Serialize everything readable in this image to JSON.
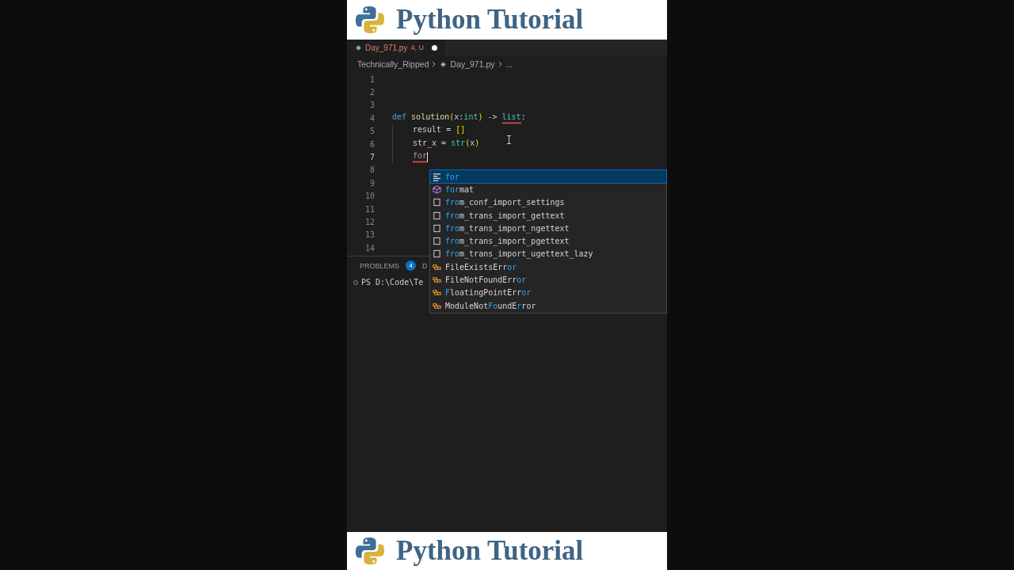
{
  "header": {
    "title": "Python Tutorial"
  },
  "tab": {
    "filename": "Day_971.py",
    "status": "4, U",
    "modified": true
  },
  "breadcrumb": {
    "folder": "Technically_Ripped",
    "file": "Day_971.py",
    "rest": "..."
  },
  "code_lines": [
    {
      "number": "1",
      "current": false
    },
    {
      "number": "2",
      "current": false
    },
    {
      "number": "3",
      "current": false
    },
    {
      "number": "4",
      "current": false,
      "tokens": [
        {
          "text": "def ",
          "kind": "keyword"
        },
        {
          "text": "solution",
          "kind": "function"
        },
        {
          "text": "(",
          "kind": "bracket"
        },
        {
          "text": "x",
          "kind": "param"
        },
        {
          "text": ":",
          "kind": "plain"
        },
        {
          "text": "int",
          "kind": "type"
        },
        {
          "text": ")",
          "kind": "bracket"
        },
        {
          "text": " -> ",
          "kind": "plain"
        },
        {
          "text": "list",
          "kind": "type",
          "error": true
        },
        {
          "text": ":",
          "kind": "plain"
        }
      ]
    },
    {
      "number": "5",
      "current": false,
      "indented": true,
      "tokens": [
        {
          "text": "result = ",
          "kind": "plain"
        },
        {
          "text": "[]",
          "kind": "bracket"
        }
      ]
    },
    {
      "number": "6",
      "current": false,
      "indented": true,
      "tokens": [
        {
          "text": "str_x = ",
          "kind": "plain"
        },
        {
          "text": "str",
          "kind": "type"
        },
        {
          "text": "(",
          "kind": "bracket"
        },
        {
          "text": "x",
          "kind": "param"
        },
        {
          "text": ")",
          "kind": "bracket"
        }
      ]
    },
    {
      "number": "7",
      "current": true,
      "indented": true,
      "tokens": [
        {
          "text": "for",
          "kind": "keyword2",
          "error": true
        }
      ]
    },
    {
      "number": "8",
      "current": false
    },
    {
      "number": "9",
      "current": false
    },
    {
      "number": "10",
      "current": false
    },
    {
      "number": "11",
      "current": false
    },
    {
      "number": "12",
      "current": false
    },
    {
      "number": "13",
      "current": false
    },
    {
      "number": "14",
      "current": false
    }
  ],
  "panel": {
    "tab": "PROBLEMS",
    "count": "4",
    "next_tab": "D",
    "terminal": "PS D:\\Code\\Te"
  },
  "suggestions": [
    {
      "kind": "keyword",
      "selected": true,
      "segments": [
        {
          "text": "for",
          "match": true
        }
      ]
    },
    {
      "kind": "method",
      "selected": false,
      "segments": [
        {
          "text": "for",
          "match": true
        },
        {
          "text": "mat",
          "match": false
        }
      ]
    },
    {
      "kind": "snippet",
      "selected": false,
      "segments": [
        {
          "text": "fro",
          "match": true
        },
        {
          "text": "m_conf_import_settings",
          "match": false
        }
      ]
    },
    {
      "kind": "snippet",
      "selected": false,
      "segments": [
        {
          "text": "fro",
          "match": true
        },
        {
          "text": "m_trans_import_gettext",
          "match": false
        }
      ]
    },
    {
      "kind": "snippet",
      "selected": false,
      "segments": [
        {
          "text": "fro",
          "match": true
        },
        {
          "text": "m_trans_import_ngettext",
          "match": false
        }
      ]
    },
    {
      "kind": "snippet",
      "selected": false,
      "segments": [
        {
          "text": "fro",
          "match": true
        },
        {
          "text": "m_trans_import_pgettext",
          "match": false
        }
      ]
    },
    {
      "kind": "snippet",
      "selected": false,
      "segments": [
        {
          "text": "fro",
          "match": true
        },
        {
          "text": "m_trans_import_ugettext_lazy",
          "match": false
        }
      ]
    },
    {
      "kind": "class",
      "selected": false,
      "segments": [
        {
          "text": "FileExistsErr",
          "match": false
        },
        {
          "text": "or",
          "match": true
        }
      ]
    },
    {
      "kind": "class",
      "selected": false,
      "segments": [
        {
          "text": "FileNotFoundErr",
          "match": false
        },
        {
          "text": "or",
          "match": true
        }
      ]
    },
    {
      "kind": "class",
      "selected": false,
      "segments": [
        {
          "text": "F",
          "match": true
        },
        {
          "text": "loatingPointErr",
          "match": false
        },
        {
          "text": "or",
          "match": true
        }
      ]
    },
    {
      "kind": "class",
      "selected": false,
      "segments": [
        {
          "text": "ModuleNot",
          "match": false
        },
        {
          "text": "Fo",
          "match": true
        },
        {
          "text": "undE",
          "match": false
        },
        {
          "text": "r",
          "match": true
        },
        {
          "text": "ror",
          "match": false
        }
      ]
    }
  ],
  "footer": {
    "title": "Python Tutorial"
  }
}
